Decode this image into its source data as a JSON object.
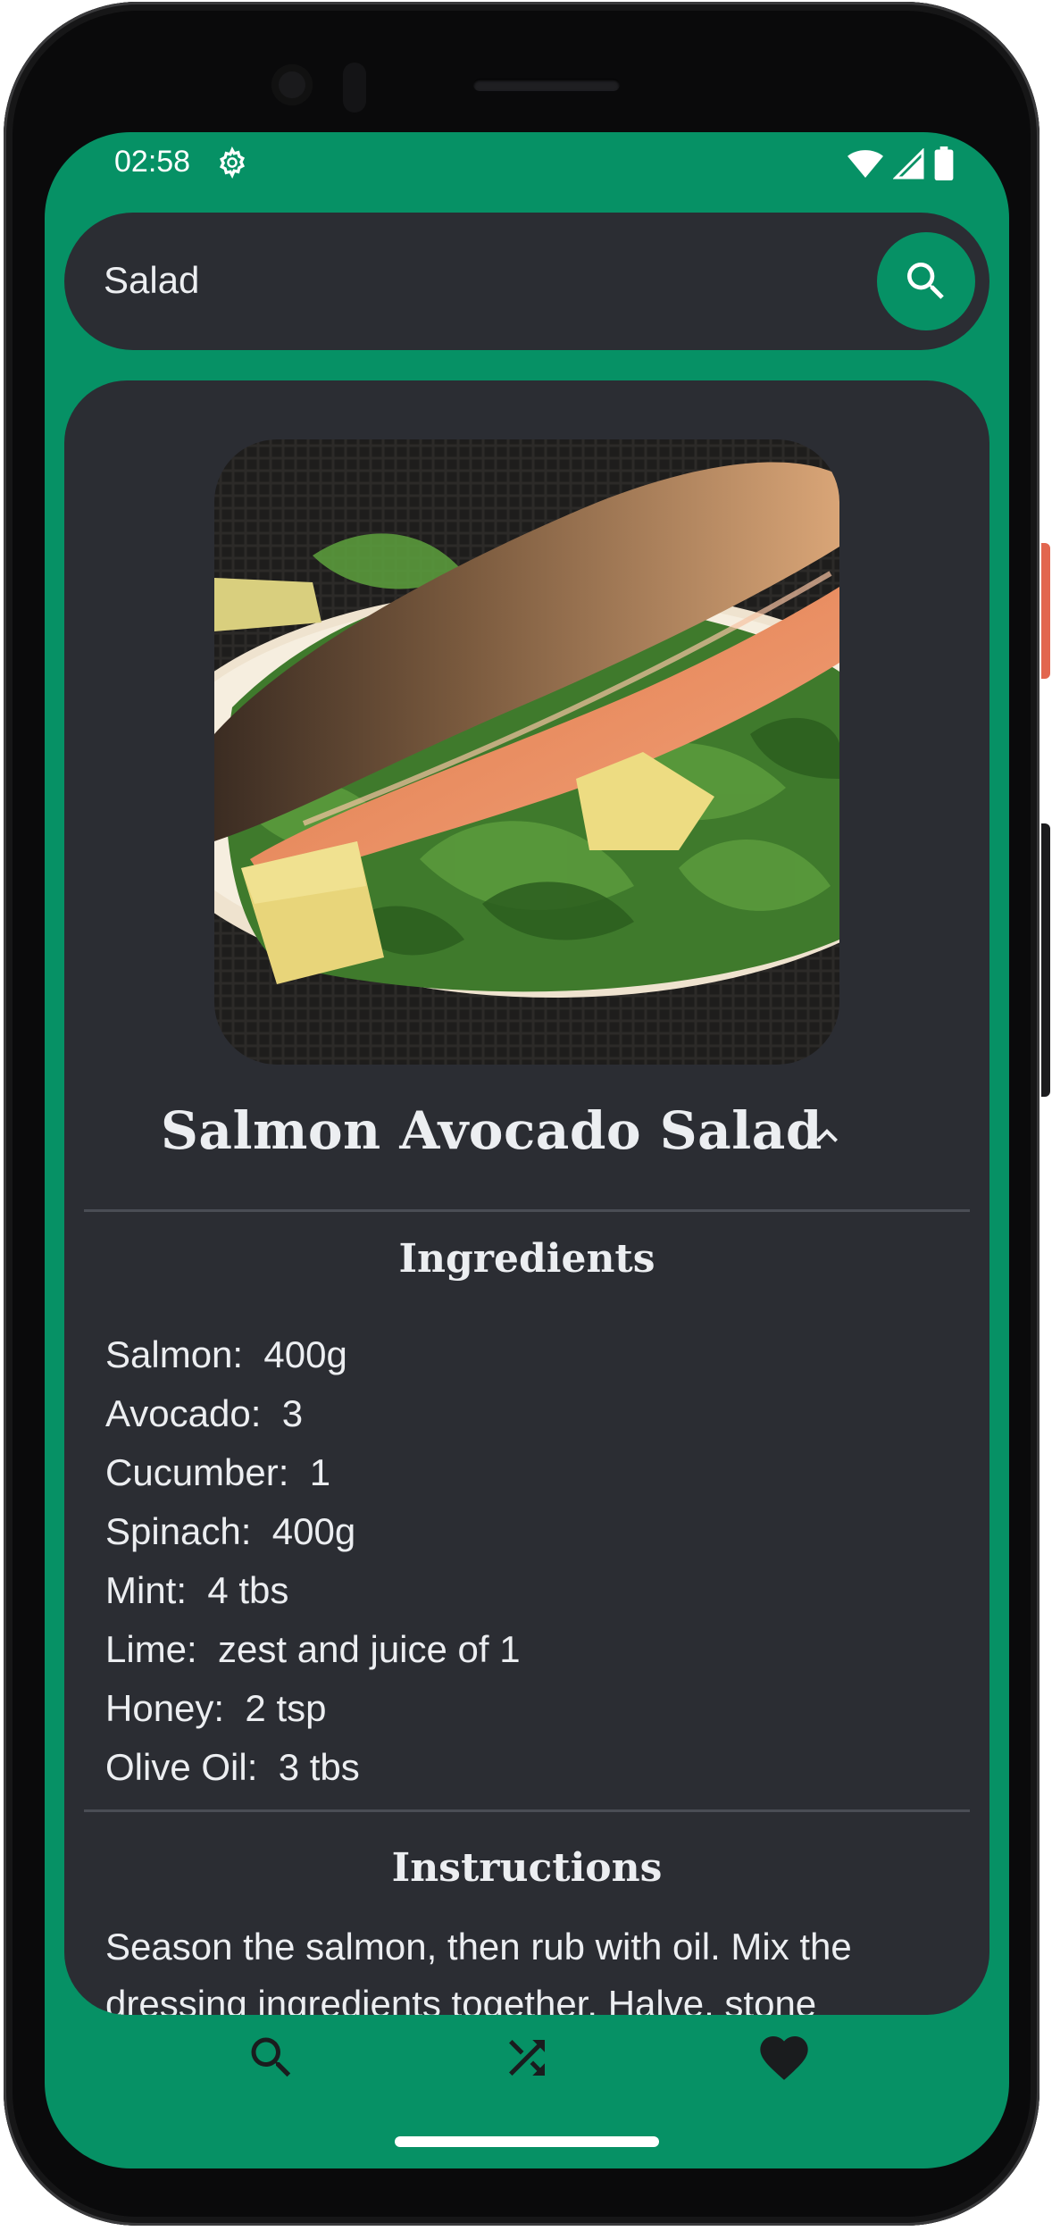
{
  "status_bar": {
    "time": "02:58",
    "icons": [
      "gear-icon",
      "wifi-icon",
      "signal-icon",
      "battery-icon"
    ]
  },
  "search": {
    "value": "Salad",
    "button_icon": "search-icon"
  },
  "recipe": {
    "title": "Salmon Avocado Salad",
    "collapse_icon": "chevron-up-icon",
    "ingredients_heading": "Ingredients",
    "ingredients": [
      {
        "name": "Salmon:",
        "amount": "400g"
      },
      {
        "name": "Avocado:",
        "amount": "3"
      },
      {
        "name": "Cucumber:",
        "amount": "1"
      },
      {
        "name": "Spinach:",
        "amount": "400g"
      },
      {
        "name": "Mint:",
        "amount": "4 tbs"
      },
      {
        "name": "Lime:",
        "amount": "zest and juice of 1"
      },
      {
        "name": "Honey:",
        "amount": "2 tsp"
      },
      {
        "name": "Olive Oil:",
        "amount": "3 tbs"
      }
    ],
    "instructions_heading": "Instructions",
    "instructions": "Season the salmon, then rub with oil. Mix the dressing ingredients together. Halve, stone"
  },
  "bottom_nav": [
    {
      "icon": "search-icon"
    },
    {
      "icon": "shuffle-icon"
    },
    {
      "icon": "heart-icon"
    }
  ],
  "colors": {
    "accent": "#069165",
    "surface": "#2b2d33",
    "text": "#eceef1"
  }
}
